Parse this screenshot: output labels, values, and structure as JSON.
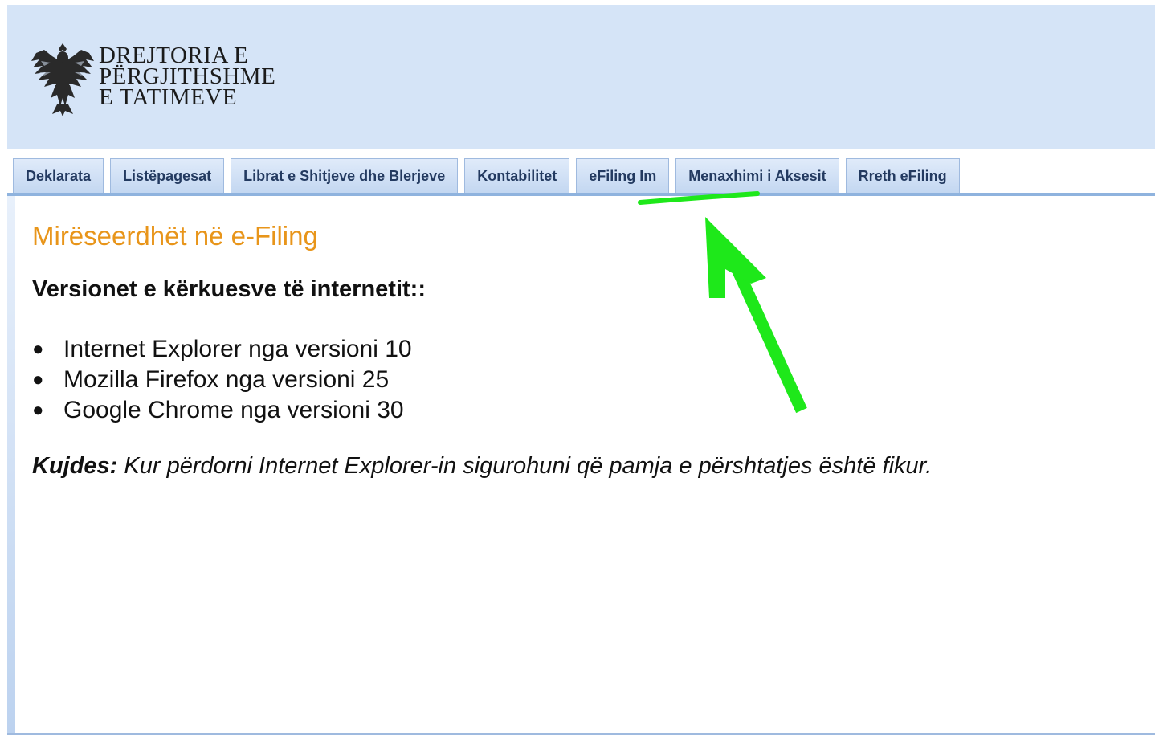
{
  "header": {
    "logo_lines": [
      "DREJTORIA E",
      "PËRGJITHSHME",
      "E TATIMEVE"
    ],
    "background_color": "#d5e4f7"
  },
  "nav": {
    "tabs": [
      {
        "label": "Deklarata"
      },
      {
        "label": "Listëpagesat"
      },
      {
        "label": "Librat e Shitjeve dhe Blerjeve"
      },
      {
        "label": "Kontabilitet"
      },
      {
        "label": "eFiling Im"
      },
      {
        "label": "Menaxhimi i Aksesit"
      },
      {
        "label": "Rreth eFiling"
      }
    ]
  },
  "content": {
    "title": "Mirëseerdhët në e-Filing",
    "subheading": "Versionet e kërkuesve të internetit::",
    "browsers": [
      "Internet Explorer nga versioni 10",
      "Mozilla Firefox nga versioni 25",
      "Google Chrome nga versioni 30"
    ],
    "note_label": "Kujdes:",
    "note_text": " Kur përdorni Internet Explorer-in sigurohuni që pamja e përshtatjes është fikur."
  },
  "annotation": {
    "description_icon": "green-arrow-icon",
    "color": "#1ee81a",
    "points_to": "eFiling Im"
  },
  "colors": {
    "title": "#e8951a",
    "tab_text": "#233a60",
    "tab_border": "#9fbadf"
  }
}
